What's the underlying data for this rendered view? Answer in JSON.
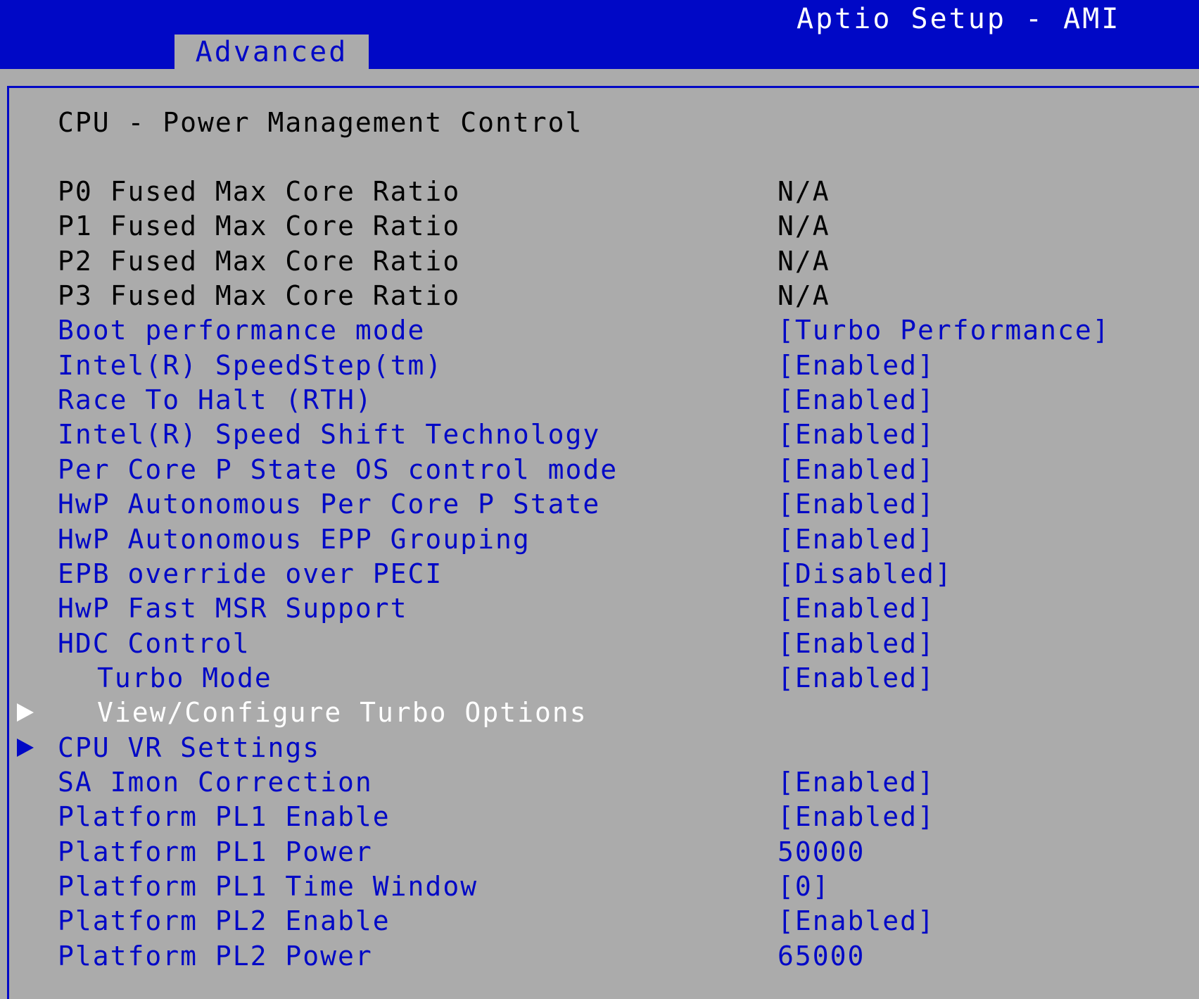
{
  "header": {
    "app_title": "Aptio Setup - AMI",
    "active_tab": "Advanced",
    "colors": {
      "bar": "#0008c6",
      "background": "#ababab",
      "highlight": "#ffffff"
    }
  },
  "page": {
    "title": "CPU - Power Management Control"
  },
  "rows": [
    {
      "label": "P0 Fused Max Core Ratio",
      "value": "N/A",
      "kind": "info"
    },
    {
      "label": "P1 Fused Max Core Ratio",
      "value": "N/A",
      "kind": "info"
    },
    {
      "label": "P2 Fused Max Core Ratio",
      "value": "N/A",
      "kind": "info"
    },
    {
      "label": "P3 Fused Max Core Ratio",
      "value": "N/A",
      "kind": "info"
    },
    {
      "label": "Boot performance mode",
      "value": "[Turbo Performance]",
      "kind": "option"
    },
    {
      "label": "Intel(R) SpeedStep(tm)",
      "value": "[Enabled]",
      "kind": "option"
    },
    {
      "label": "Race To Halt (RTH)",
      "value": "[Enabled]",
      "kind": "option"
    },
    {
      "label": "Intel(R) Speed Shift Technology",
      "value": "[Enabled]",
      "kind": "option"
    },
    {
      "label": "Per Core P State OS control mode",
      "value": "[Enabled]",
      "kind": "option"
    },
    {
      "label": "HwP Autonomous Per Core P State",
      "value": "[Enabled]",
      "kind": "option"
    },
    {
      "label": "HwP Autonomous EPP Grouping",
      "value": "[Enabled]",
      "kind": "option"
    },
    {
      "label": "EPB override over PECI",
      "value": "[Disabled]",
      "kind": "option"
    },
    {
      "label": "HwP Fast MSR Support",
      "value": "[Enabled]",
      "kind": "option"
    },
    {
      "label": "HDC Control",
      "value": "[Enabled]",
      "kind": "option"
    },
    {
      "label": "Turbo Mode",
      "value": "[Enabled]",
      "kind": "option",
      "indent": true
    },
    {
      "label": "View/Configure Turbo Options",
      "value": "",
      "kind": "selected",
      "indent": true,
      "arrow": "triangle-right-icon"
    },
    {
      "label": "CPU VR Settings",
      "value": "",
      "kind": "submenu",
      "arrow": "triangle-right-icon"
    },
    {
      "label": "SA Imon Correction",
      "value": "[Enabled]",
      "kind": "option"
    },
    {
      "label": "Platform PL1 Enable",
      "value": "[Enabled]",
      "kind": "option"
    },
    {
      "label": "Platform PL1 Power",
      "value": "50000",
      "kind": "option"
    },
    {
      "label": "Platform PL1 Time Window",
      "value": "[0]",
      "kind": "option"
    },
    {
      "label": "Platform PL2 Enable",
      "value": "[Enabled]",
      "kind": "option"
    },
    {
      "label": "Platform PL2 Power",
      "value": "65000",
      "kind": "option"
    }
  ]
}
